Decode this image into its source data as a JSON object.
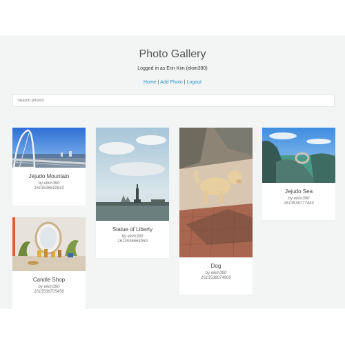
{
  "header": {
    "title": "Photo Gallery",
    "logged_in": "Logged in as Erin Kim (ekim390)"
  },
  "nav": {
    "home": "Home",
    "add_photo": "Add Photo",
    "logout": "Logout",
    "separator": "|"
  },
  "search": {
    "placeholder": "Search photos"
  },
  "photos": [
    {
      "title": "Jejudo Mountain",
      "by": "by ekim390",
      "timestamp": "1613536810610"
    },
    {
      "title": "Statue of Liberty",
      "by": "by ekim390",
      "timestamp": "1613536664959"
    },
    {
      "title": "Dog",
      "by": "by ekim390",
      "timestamp": "1613538074900"
    },
    {
      "title": "Jejudo Sea",
      "by": "by ekim390",
      "timestamp": "1613536777443"
    },
    {
      "title": "Candle Shop",
      "by": "by ekim390",
      "timestamp": "1613536705456"
    }
  ]
}
